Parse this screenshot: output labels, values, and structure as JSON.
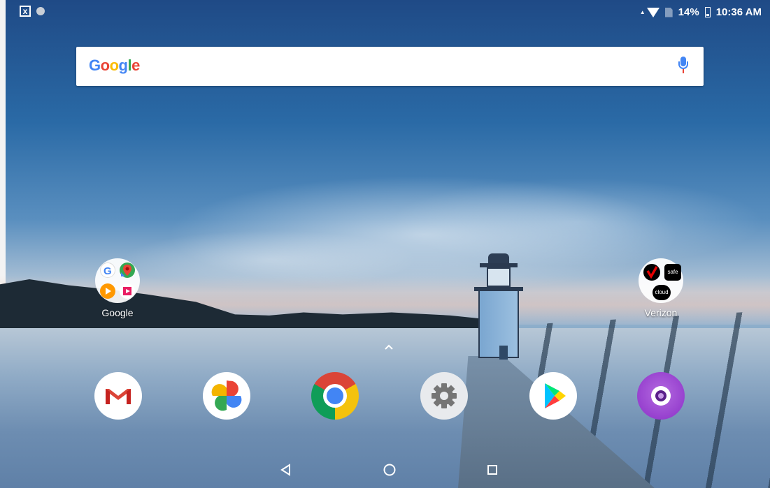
{
  "status_bar": {
    "battery": "14%",
    "time": "10:36 AM",
    "icons": [
      "screenshot-notification-icon",
      "circle-notification-icon",
      "wifi-icon",
      "no-sim-icon",
      "battery-icon"
    ]
  },
  "search": {
    "logo_text": "Google",
    "mic_icon": "microphone-icon"
  },
  "home": {
    "folders": [
      {
        "label": "Google",
        "apps": [
          "google",
          "maps",
          "play-music",
          "play-movies"
        ]
      },
      {
        "label": "Verizon",
        "apps": [
          "verizon",
          "safe",
          "cloud"
        ]
      }
    ],
    "mini_labels": {
      "safe": "safe",
      "cloud": "cloud"
    },
    "drawer_handle": "^"
  },
  "dock": {
    "apps": [
      "Gmail",
      "Photos",
      "Chrome",
      "Settings",
      "Play Store",
      "Camera"
    ]
  },
  "navigation": {
    "buttons": [
      "back",
      "home",
      "recents"
    ]
  },
  "colors": {
    "google_blue": "#4285f4",
    "google_red": "#ea4335",
    "google_yellow": "#fbbc05",
    "google_green": "#34a853",
    "camera_purple": "#9b3fd4"
  }
}
